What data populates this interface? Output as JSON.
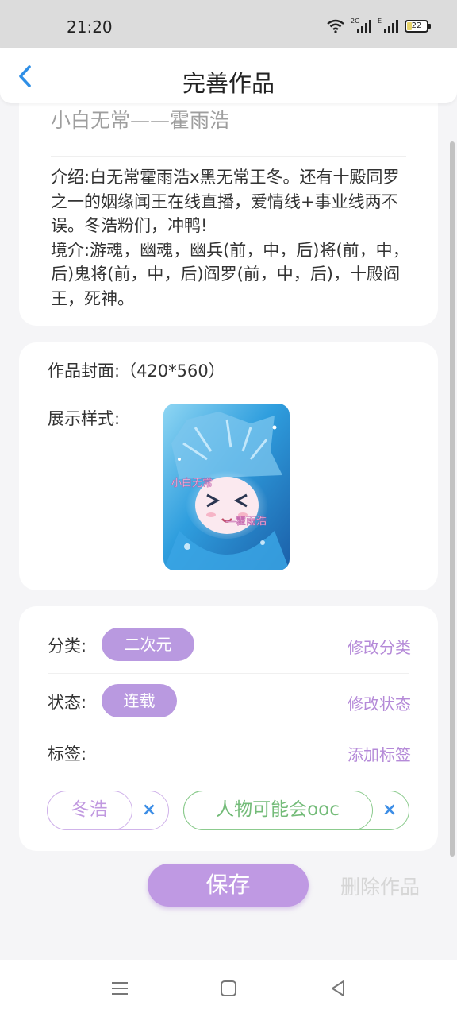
{
  "status_bar": {
    "time": "21:20",
    "signal1_label": "2G",
    "signal2_label": "E",
    "battery": "22",
    "icons": [
      "wifi-icon",
      "signal-icon",
      "signal-icon",
      "battery-icon"
    ]
  },
  "header": {
    "title": "完善作品",
    "back_icon": "chevron-left-icon",
    "accent_color": "#2f8fe6"
  },
  "work": {
    "title": "小白无常——霍雨浩",
    "intro_lines": [
      "介绍:白无常霍雨浩x黑无常王冬。还有十殿同罗之一的姻缘闻王在线直播，爱情线+事业线两不误。冬浩粉们，冲鸭!",
      "境介:游魂，幽魂，幽兵(前，中，后)将(前，中，后)鬼将(前，中，后)阎罗(前，中，后)，十殿阎王，死神。"
    ]
  },
  "cover": {
    "label": "作品封面:（420*560）",
    "display_label": "展示样式:",
    "image_text_1": "小白无常",
    "image_text_2": "—霍雨浩"
  },
  "meta": {
    "category_label": "分类:",
    "category_value": "二次元",
    "category_action": "修改分类",
    "status_label": "状态:",
    "status_value": "连载",
    "status_action": "修改状态",
    "tags_label": "标签:",
    "tags_action": "添加标签",
    "tags": [
      {
        "text": "冬浩",
        "remove": "×"
      },
      {
        "text": "人物可能会ooc",
        "remove": "×"
      }
    ],
    "pill_color": "#b999e0"
  },
  "actions": {
    "save": "保存",
    "delete": "删除作品"
  },
  "nav": {
    "icons": [
      "menu-icon",
      "home-square-icon",
      "back-triangle-icon"
    ]
  }
}
